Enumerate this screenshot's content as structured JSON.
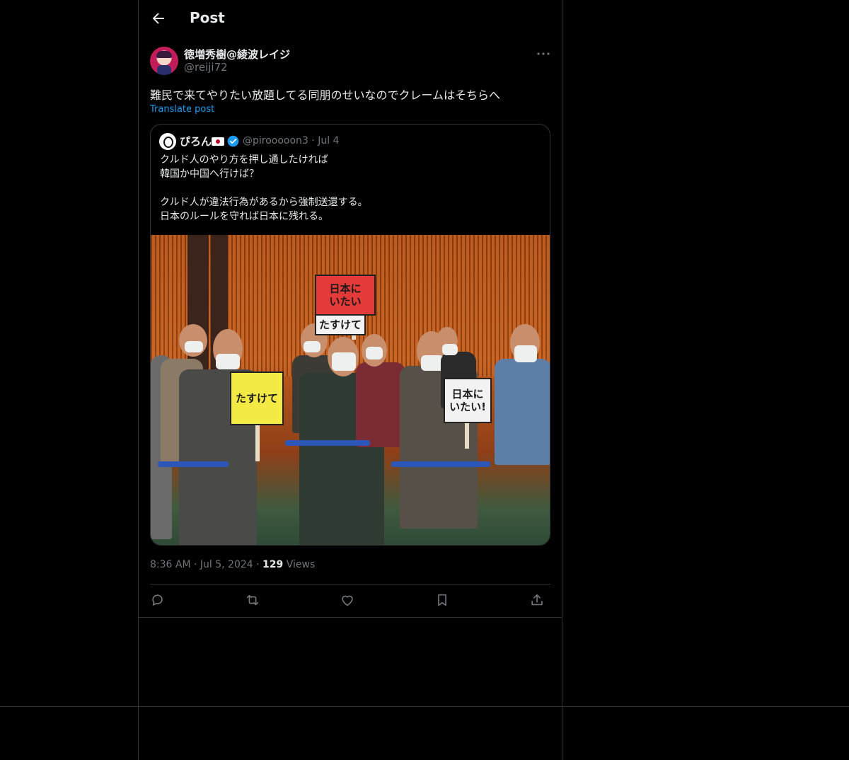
{
  "header": {
    "title": "Post"
  },
  "post": {
    "author_name": "徳増秀樹@綾波レイジ",
    "author_handle": "@reiji72",
    "text": "難民で来てやりたい放題してる同朋のせいなのでクレームはそちらへ",
    "translate_label": "Translate post",
    "time": "8:36 AM",
    "date": "Jul 5, 2024",
    "views_count": "129",
    "views_label": "Views"
  },
  "quote": {
    "author_name": "ぴろん",
    "author_handle": "@pirooooon3",
    "date": "Jul 4",
    "text": "クルド人のやり方を押し通したければ\n韓国か中国へ行けば？\n\nクルド人が違法行為があるから強制送還する。\n日本のルールを守れば日本に残れる。"
  },
  "photo": {
    "signs": [
      "日本に\nいたい",
      "たすけて",
      "たすけて",
      "日本に\nいたい!"
    ]
  },
  "icons": {
    "back": "arrow-left-icon",
    "more": "more-dots-icon",
    "verified": "verified-badge-icon",
    "flag": "japan-flag-icon",
    "reply": "reply-icon",
    "repost": "repost-icon",
    "like": "like-heart-icon",
    "bookmark": "bookmark-icon",
    "share": "share-icon"
  },
  "colors": {
    "background": "#000000",
    "text": "#e7e9ea",
    "muted": "#71767b",
    "link": "#1d9bf0",
    "border": "#2f3336",
    "verified": "#1d9bf0"
  }
}
